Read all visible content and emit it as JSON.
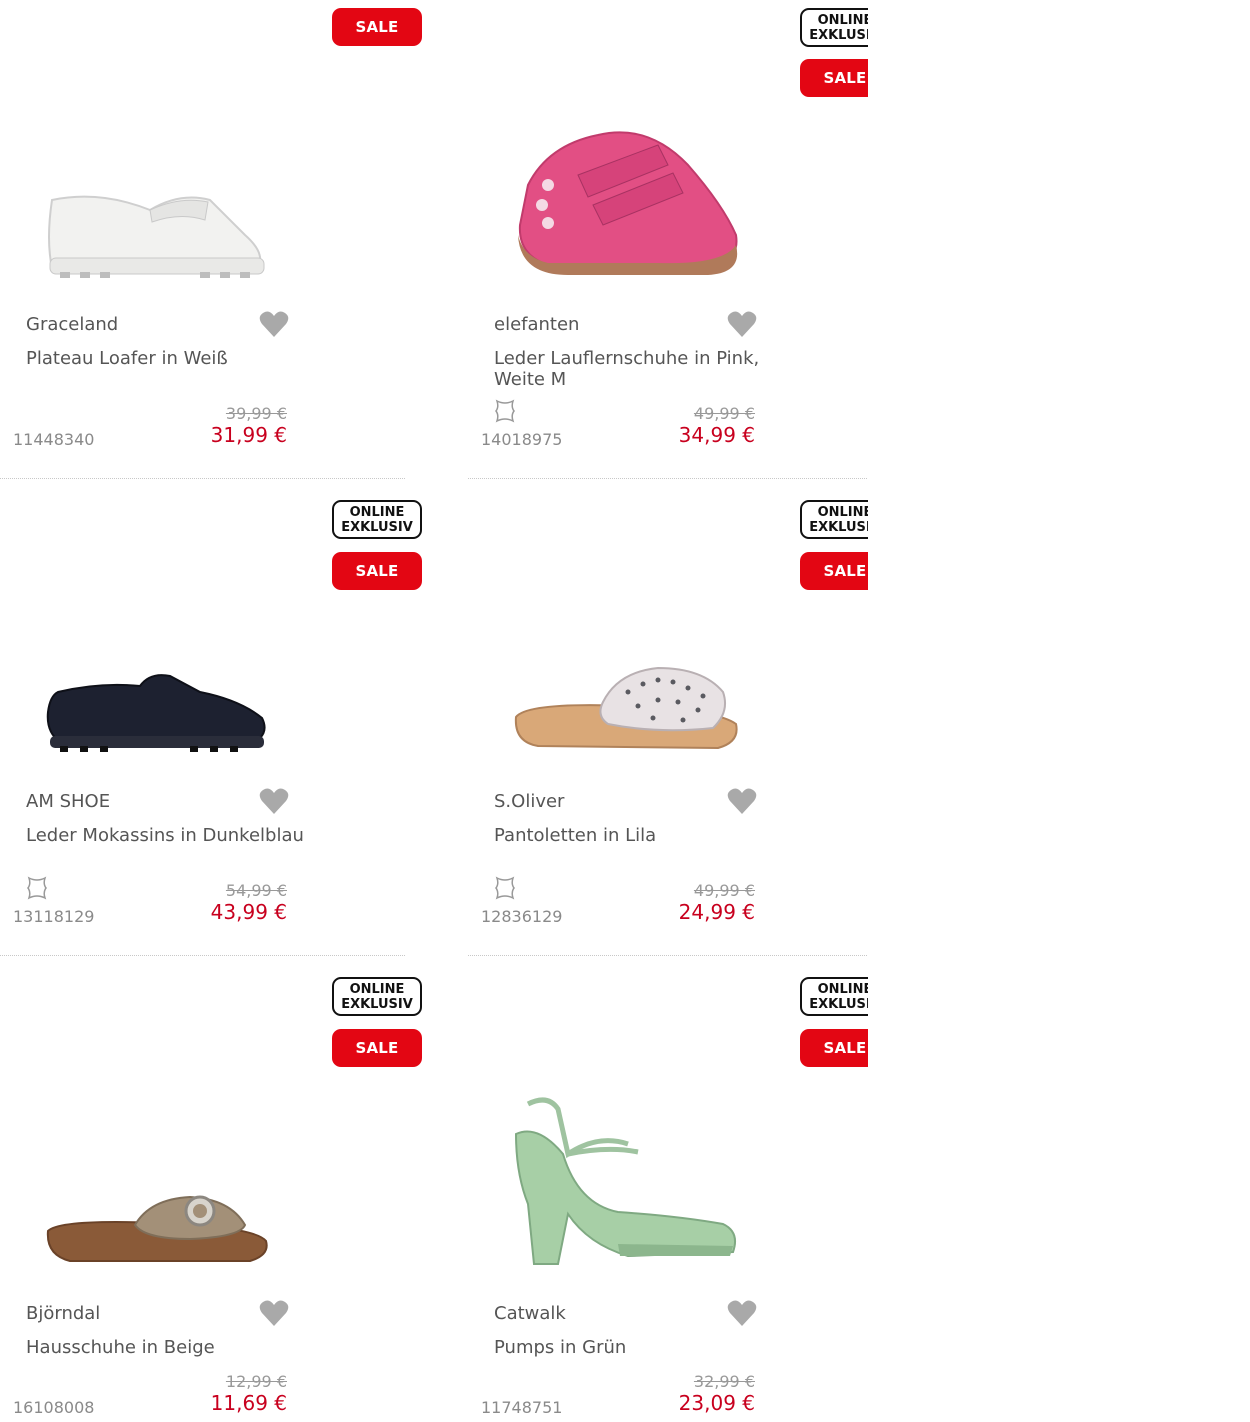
{
  "products": [
    {
      "brand": "Graceland",
      "title": "Plateau Loafer in Weiß",
      "sku": "11448340",
      "old_price": "39,99 €",
      "new_price": "31,99 €",
      "sale": "SALE",
      "online": "",
      "leather": false,
      "shoe_icon": "white-loafer"
    },
    {
      "brand": "elefanten",
      "title": "Leder Lauflernschuhe in Pink, Weite M",
      "sku": "14018975",
      "old_price": "49,99 €",
      "new_price": "34,99 €",
      "sale": "SALE",
      "online": "ONLINE EXKLUSIV",
      "leather": true,
      "shoe_icon": "pink-kids-shoe"
    },
    {
      "brand": "AM SHOE",
      "title": "Leder Mokassins in Dunkelblau",
      "sku": "13118129",
      "old_price": "54,99 €",
      "new_price": "43,99 €",
      "sale": "SALE",
      "online": "ONLINE EXKLUSIV",
      "leather": true,
      "shoe_icon": "dark-moccasin"
    },
    {
      "brand": "S.Oliver",
      "title": "Pantoletten in Lila",
      "sku": "12836129",
      "old_price": "49,99 €",
      "new_price": "24,99 €",
      "sale": "SALE",
      "online": "ONLINE EXKLUSIV",
      "leather": true,
      "shoe_icon": "studded-slide"
    },
    {
      "brand": "Björndal",
      "title": "Hausschuhe in Beige",
      "sku": "16108008",
      "old_price": "12,99 €",
      "new_price": "11,69 €",
      "sale": "SALE",
      "online": "ONLINE EXKLUSIV",
      "leather": false,
      "shoe_icon": "beige-slipper"
    },
    {
      "brand": "Catwalk",
      "title": "Pumps in Grün",
      "sku": "11748751",
      "old_price": "32,99 €",
      "new_price": "23,09 €",
      "sale": "SALE",
      "online": "ONLINE EXKLUSIV",
      "leather": false,
      "shoe_icon": "green-pump"
    }
  ],
  "badges": {
    "online_line1": "ONLINE",
    "online_line2": "EXKLUSIV"
  }
}
